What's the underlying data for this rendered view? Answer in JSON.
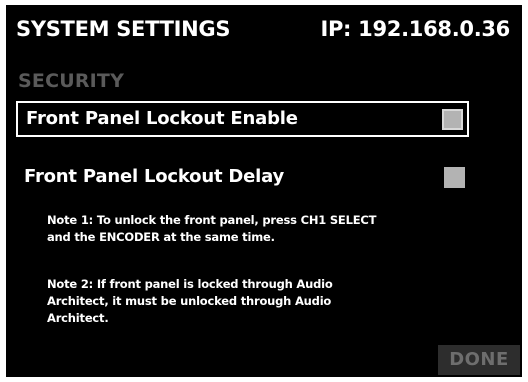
{
  "header": {
    "title": "SYSTEM SETTINGS",
    "ip": "IP: 192.168.0.36"
  },
  "section": {
    "title": "SECURITY"
  },
  "settings": [
    {
      "label": "Front Panel Lockout Enable",
      "checked": false,
      "selected": true
    },
    {
      "label": "Front Panel Lockout Delay",
      "checked": false,
      "selected": false
    }
  ],
  "notes": [
    {
      "lines": [
        "Note 1: To unlock the front panel, press CH1 SELECT",
        "and the ENCODER at the same time."
      ]
    },
    {
      "lines": [
        "Note 2: If front panel is locked through Audio",
        "Architect, it must be unlocked through Audio",
        "Architect."
      ]
    }
  ],
  "done_button": {
    "label": "DONE",
    "enabled": false
  },
  "colors": {
    "background": "#000000",
    "text": "#ffffff",
    "section_title": "#5a5a5a",
    "checkbox": "#b3b3b3",
    "disabled_button_bg": "#2d2d2d",
    "disabled_button_text": "#6e6e6e"
  }
}
